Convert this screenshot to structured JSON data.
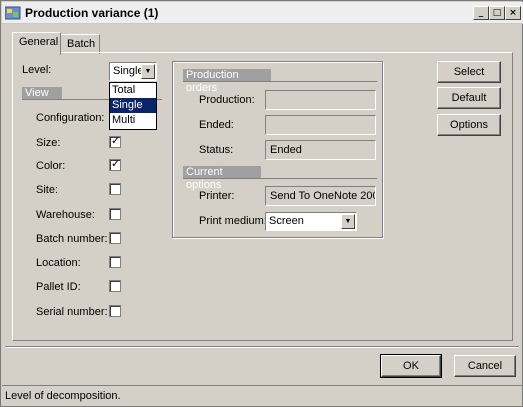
{
  "window": {
    "title": "Production variance (1)",
    "controls": {
      "minimize": "_",
      "maximize": "□",
      "close": "×"
    }
  },
  "tabs": [
    {
      "label": "General",
      "active": true
    },
    {
      "label": "Batch",
      "active": false
    }
  ],
  "level": {
    "label": "Level:",
    "value": "Single",
    "options": [
      "Total",
      "Single",
      "Multi"
    ],
    "selected_option": "Single"
  },
  "view": {
    "header": "View",
    "items": [
      {
        "label": "Configuration:",
        "checked": false
      },
      {
        "label": "Size:",
        "checked": true
      },
      {
        "label": "Color:",
        "checked": true
      },
      {
        "label": "Site:",
        "checked": false
      },
      {
        "label": "Warehouse:",
        "checked": false
      },
      {
        "label": "Batch number:",
        "checked": false
      },
      {
        "label": "Location:",
        "checked": false
      },
      {
        "label": "Pallet ID:",
        "checked": false
      },
      {
        "label": "Serial number:",
        "checked": false
      }
    ]
  },
  "production_orders": {
    "header": "Production orders",
    "production_label": "Production:",
    "production_value": "",
    "ended_label": "Ended:",
    "ended_value": "",
    "status_label": "Status:",
    "status_value": "Ended"
  },
  "current_options": {
    "header": "Current options",
    "printer_label": "Printer:",
    "printer_value": "Send To OneNote 200",
    "print_medium_label": "Print medium:",
    "print_medium_value": "Screen"
  },
  "side_buttons": {
    "select": "Select",
    "default": "Default",
    "options": "Options"
  },
  "footer_buttons": {
    "ok": "OK",
    "cancel": "Cancel"
  },
  "status_bar": {
    "text": "Level of decomposition."
  },
  "colors": {
    "face": "#d4d0c8",
    "selection": "#0a246a",
    "section_header": "#a0a0a0"
  }
}
